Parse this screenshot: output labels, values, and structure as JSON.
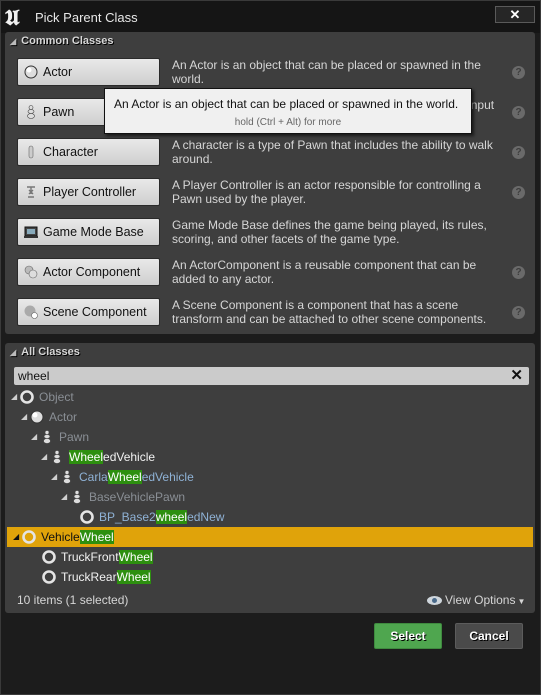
{
  "window": {
    "title": "Pick Parent Class",
    "close_icon": "close-icon",
    "logo_icon": "unreal-logo-icon"
  },
  "common_classes": {
    "header": "Common Classes",
    "items": [
      {
        "label": "Actor",
        "icon": "actor-sphere-icon",
        "description": "An Actor is an object that can be placed or spawned in the world.",
        "has_help": true
      },
      {
        "label": "Pawn",
        "icon": "pawn-icon",
        "description": "A Pawn is an actor that can be 'possessed' and receive input from a controller.",
        "has_help": true
      },
      {
        "label": "Character",
        "icon": "character-icon",
        "description": "A character is a type of Pawn that includes the ability to walk around.",
        "has_help": true
      },
      {
        "label": "Player Controller",
        "icon": "player-controller-icon",
        "description": "A Player Controller is an actor responsible for controlling a Pawn used by the player.",
        "has_help": true
      },
      {
        "label": "Game Mode Base",
        "icon": "game-mode-icon",
        "description": "Game Mode Base defines the game being played, its rules, scoring, and other facets of the game type.",
        "has_help": false
      },
      {
        "label": "Actor Component",
        "icon": "actor-component-icon",
        "description": "An ActorComponent is a reusable component that can be added to any actor.",
        "has_help": true
      },
      {
        "label": "Scene Component",
        "icon": "scene-component-icon",
        "description": "A Scene Component is a component that has a scene transform and can be attached to other scene components.",
        "has_help": true
      }
    ],
    "help_glyph": "?"
  },
  "tooltip": {
    "text": "An Actor is an object that can be placed or spawned in the world.",
    "hint": "hold (Ctrl + Alt) for more"
  },
  "all_classes": {
    "header": "All Classes",
    "search": {
      "value": "wheel",
      "placeholder": "",
      "clear_glyph": "✕"
    },
    "tree": [
      {
        "pre": "Object",
        "match": "",
        "post": "",
        "depth": 0,
        "icon": "object-ring-icon",
        "expanded": true,
        "style": "dim",
        "selected": false
      },
      {
        "pre": "Actor",
        "match": "",
        "post": "",
        "depth": 1,
        "icon": "actor-sphere-icon",
        "expanded": true,
        "style": "dimblue",
        "selected": false
      },
      {
        "pre": "Pawn",
        "match": "",
        "post": "",
        "depth": 2,
        "icon": "pawn-icon",
        "expanded": true,
        "style": "dimblue",
        "selected": false
      },
      {
        "pre": "",
        "match": "Wheel",
        "post": "edVehicle",
        "depth": 3,
        "icon": "pawn-icon",
        "expanded": true,
        "style": "white",
        "selected": false
      },
      {
        "pre": "Carla",
        "match": "Wheel",
        "post": "edVehicle",
        "depth": 4,
        "icon": "pawn-icon",
        "expanded": true,
        "style": "blue",
        "selected": false
      },
      {
        "pre": "BaseVehiclePawn",
        "match": "",
        "post": "",
        "depth": 5,
        "icon": "pawn-icon",
        "expanded": true,
        "style": "dimblue",
        "selected": false
      },
      {
        "pre": "BP_Base2",
        "match": "wheel",
        "post": "edNew",
        "depth": 6,
        "icon": "object-ring-icon",
        "expanded": false,
        "style": "blue",
        "selected": false
      },
      {
        "pre": "Vehicle",
        "match": "Wheel",
        "post": "",
        "depth": 0,
        "icon": "object-ring-icon",
        "expanded": true,
        "style": "dark",
        "selected": true
      },
      {
        "pre": "TruckFront",
        "match": "Wheel",
        "post": "",
        "depth": 1,
        "icon": "object-ring-icon",
        "expanded": false,
        "style": "white",
        "selected": false
      },
      {
        "pre": "TruckRear",
        "match": "Wheel",
        "post": "",
        "depth": 1,
        "icon": "object-ring-icon",
        "expanded": false,
        "style": "white",
        "selected": false
      }
    ],
    "status": "10 items (1 selected)",
    "view_options": "View Options"
  },
  "buttons": {
    "select": "Select",
    "cancel": "Cancel"
  },
  "colors": {
    "selection": "#e0a30a",
    "highlight": "#2d8f0f",
    "select_button": "#4fa64f"
  }
}
